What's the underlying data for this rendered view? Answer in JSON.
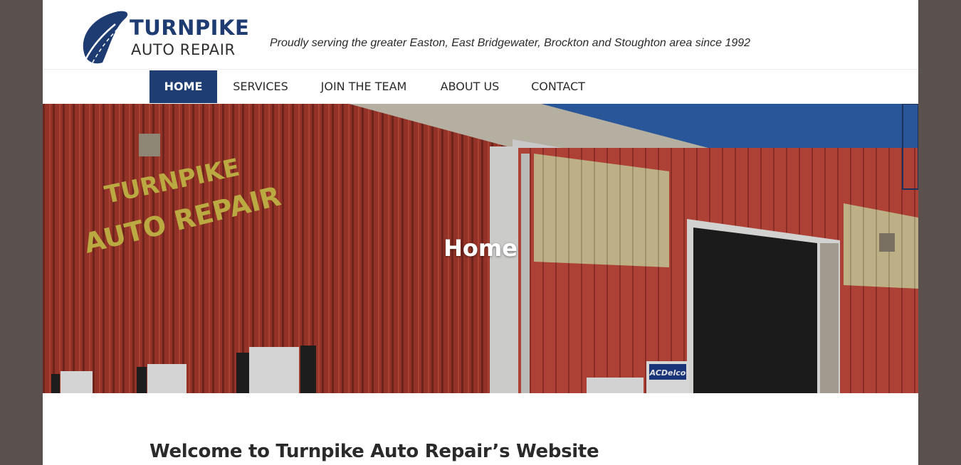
{
  "brand": {
    "name_line1": "TURNPIKE",
    "name_line2": "AUTO REPAIR",
    "tagline": "Proudly  serving the greater Easton, East Bridgewater, Brockton and Stoughton area since 1992",
    "colors": {
      "primary": "#1e3e73",
      "outer_background": "#5a514f"
    }
  },
  "nav": {
    "items": [
      {
        "label": "HOME",
        "active": true
      },
      {
        "label": "SERVICES",
        "active": false
      },
      {
        "label": "JOIN THE TEAM",
        "active": false
      },
      {
        "label": "ABOUT US",
        "active": false
      },
      {
        "label": "CONTACT",
        "active": false
      }
    ]
  },
  "hero": {
    "title": "Home",
    "image_sign_line1": "TURNPIKE",
    "image_sign_line2": "AUTO REPAIR",
    "image_dealer_sign": "ACDelco"
  },
  "main": {
    "heading": "Welcome to Turnpike Auto Repair’s Website"
  }
}
